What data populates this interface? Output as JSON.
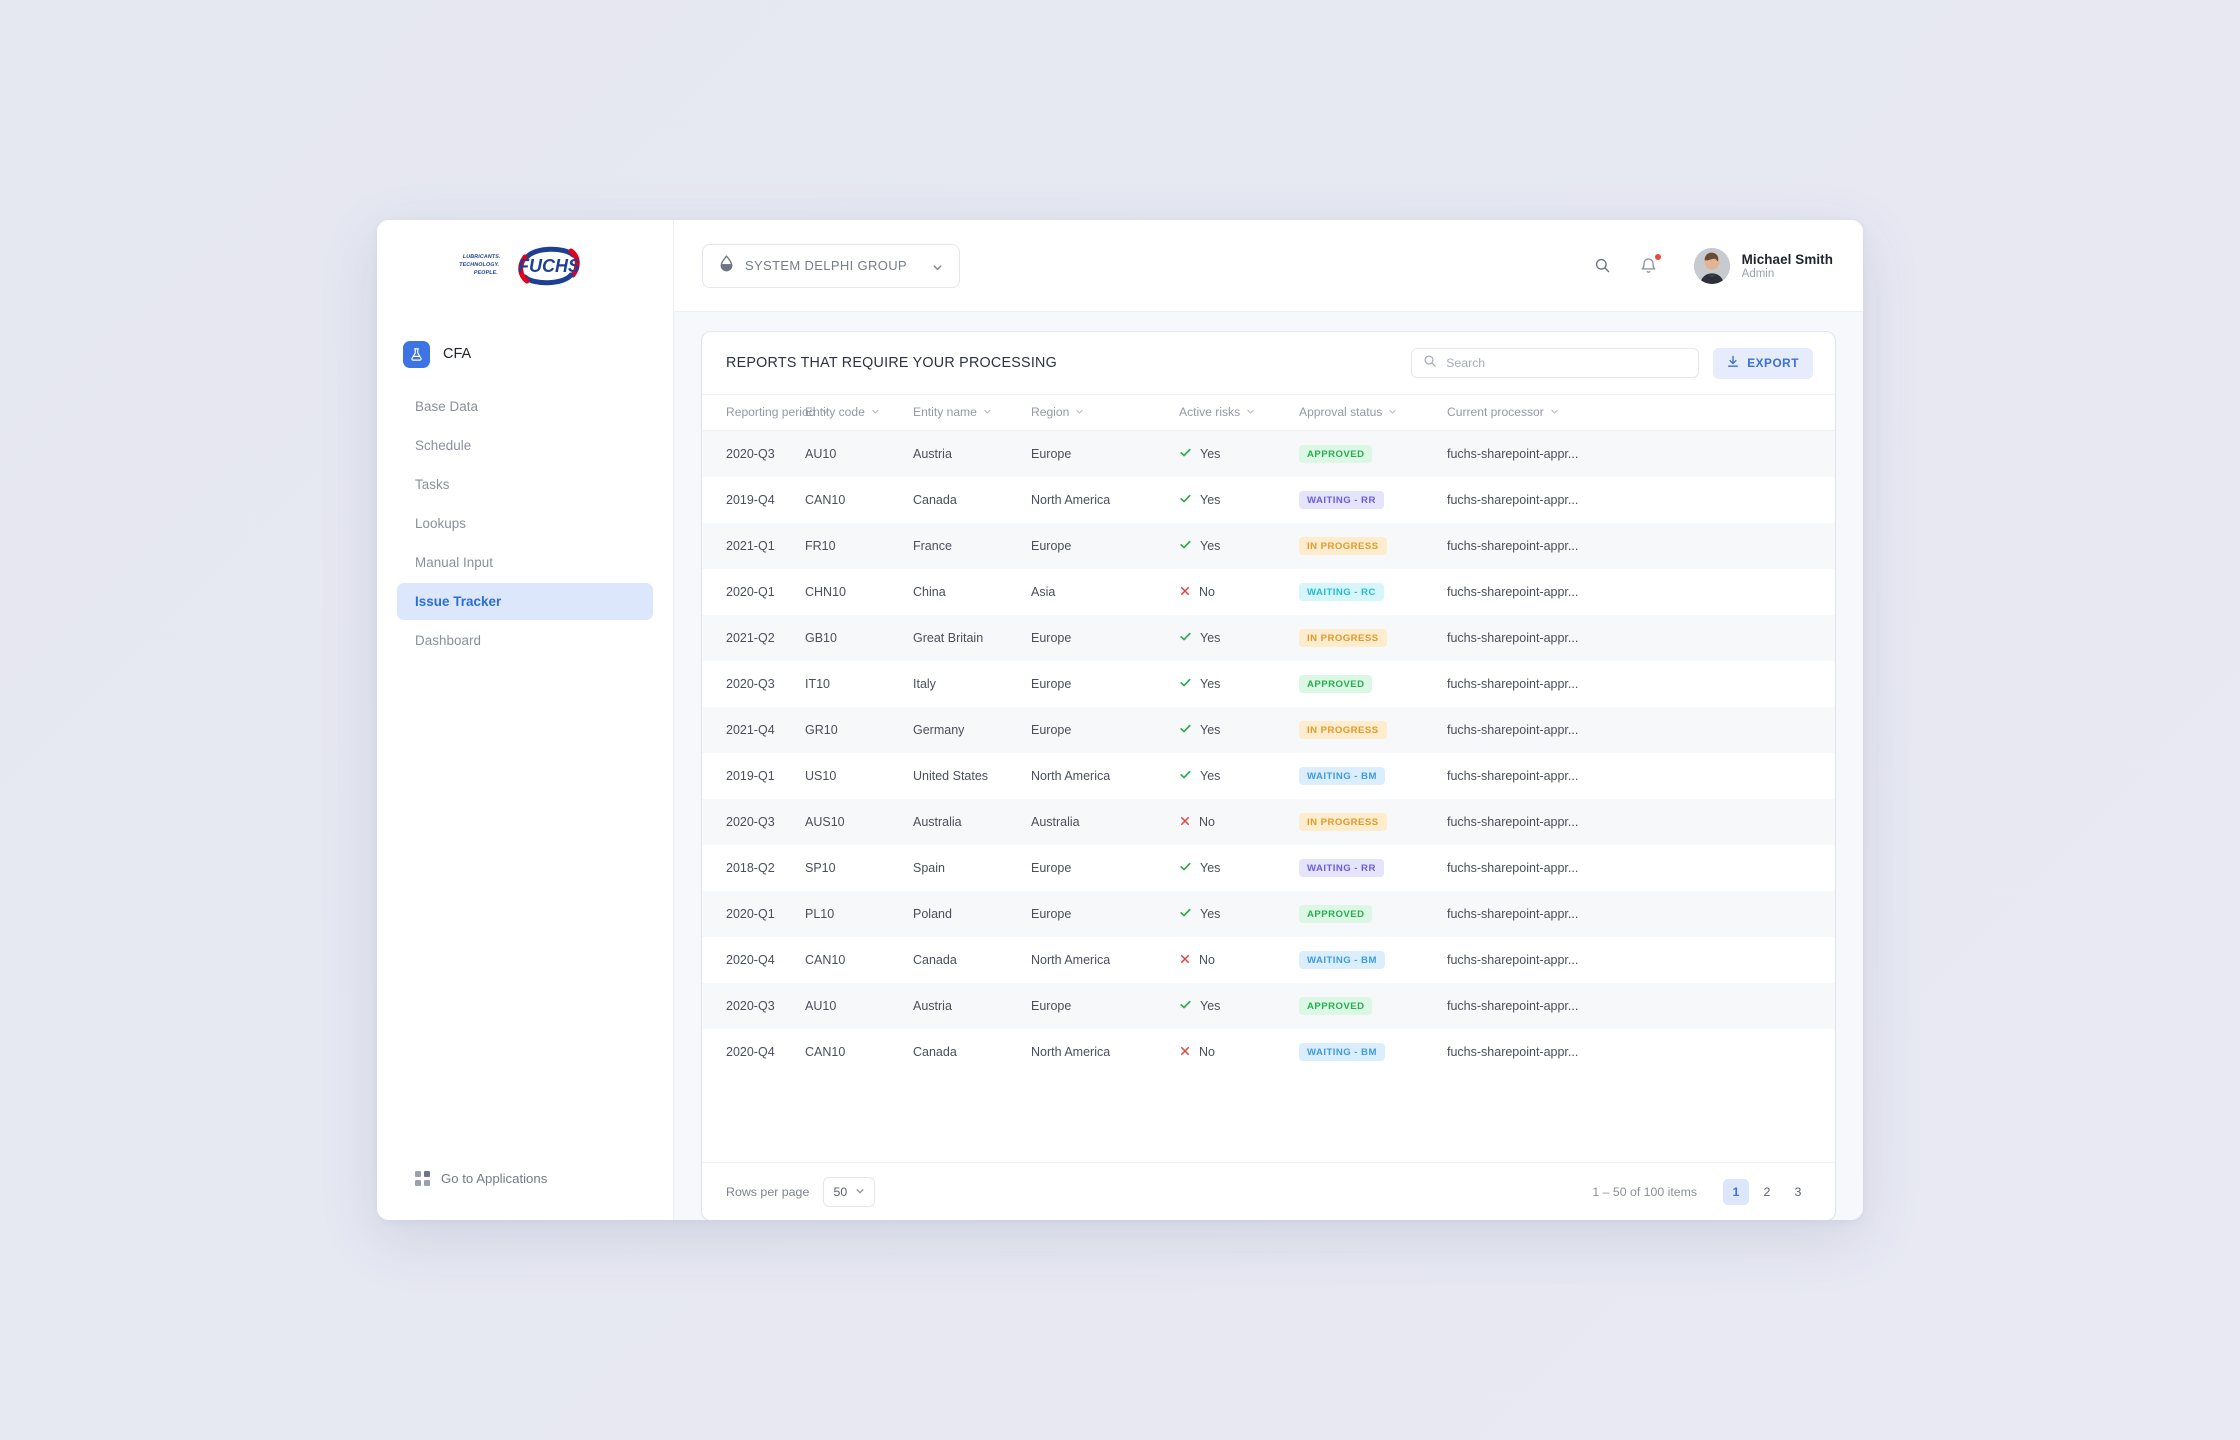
{
  "brand": {
    "logo_tagline": [
      "LUBRICANTS.",
      "TECHNOLOGY.",
      "PEOPLE."
    ],
    "logo_name": "FUCHS",
    "accent_blue": "#1d3f94",
    "accent_red": "#e2001a"
  },
  "sidebar": {
    "app_name": "CFA",
    "items": [
      {
        "label": "Base Data",
        "active": false
      },
      {
        "label": "Schedule",
        "active": false
      },
      {
        "label": "Tasks",
        "active": false
      },
      {
        "label": "Lookups",
        "active": false
      },
      {
        "label": "Manual Input",
        "active": false
      },
      {
        "label": "Issue Tracker",
        "active": true
      },
      {
        "label": "Dashboard",
        "active": false
      }
    ],
    "applications_link": "Go to Applications"
  },
  "topbar": {
    "group_selector": "SYSTEM DELPHI GROUP",
    "user_name": "Michael Smith",
    "user_role": "Admin",
    "has_notification": true
  },
  "card": {
    "title": "REPORTS THAT REQUIRE YOUR PROCESSING",
    "search_placeholder": "Search",
    "search_value": "",
    "export_label": "EXPORT"
  },
  "table": {
    "columns": [
      "Reporting period",
      "Entity code",
      "Entity name",
      "Region",
      "Active risks",
      "Approval status",
      "Current processor"
    ],
    "rows": [
      {
        "period": "2020-Q3",
        "code": "AU10",
        "name": "Austria",
        "region": "Europe",
        "risk": "Yes",
        "status": "APPROVED",
        "status_key": "approved",
        "processor": "fuchs-sharepoint-appr..."
      },
      {
        "period": "2019-Q4",
        "code": "CAN10",
        "name": "Canada",
        "region": "North America",
        "risk": "Yes",
        "status": "WAITING - RR",
        "status_key": "waiting_rr",
        "processor": "fuchs-sharepoint-appr..."
      },
      {
        "period": "2021-Q1",
        "code": "FR10",
        "name": "France",
        "region": "Europe",
        "risk": "Yes",
        "status": "IN PROGRESS",
        "status_key": "in_progress",
        "processor": "fuchs-sharepoint-appr..."
      },
      {
        "period": "2020-Q1",
        "code": "CHN10",
        "name": "China",
        "region": "Asia",
        "risk": "No",
        "status": "WAITING - RC",
        "status_key": "waiting_rc",
        "processor": "fuchs-sharepoint-appr..."
      },
      {
        "period": "2021-Q2",
        "code": "GB10",
        "name": "Great Britain",
        "region": "Europe",
        "risk": "Yes",
        "status": "IN PROGRESS",
        "status_key": "in_progress",
        "processor": "fuchs-sharepoint-appr..."
      },
      {
        "period": "2020-Q3",
        "code": "IT10",
        "name": "Italy",
        "region": "Europe",
        "risk": "Yes",
        "status": "APPROVED",
        "status_key": "approved",
        "processor": "fuchs-sharepoint-appr..."
      },
      {
        "period": "2021-Q4",
        "code": "GR10",
        "name": "Germany",
        "region": "Europe",
        "risk": "Yes",
        "status": "IN PROGRESS",
        "status_key": "in_progress",
        "processor": "fuchs-sharepoint-appr..."
      },
      {
        "period": "2019-Q1",
        "code": "US10",
        "name": "United States",
        "region": "North America",
        "risk": "Yes",
        "status": "WAITING - BM",
        "status_key": "waiting_bm",
        "processor": "fuchs-sharepoint-appr..."
      },
      {
        "period": "2020-Q3",
        "code": "AUS10",
        "name": "Australia",
        "region": "Australia",
        "risk": "No",
        "status": "IN PROGRESS",
        "status_key": "in_progress",
        "processor": "fuchs-sharepoint-appr..."
      },
      {
        "period": "2018-Q2",
        "code": "SP10",
        "name": "Spain",
        "region": "Europe",
        "risk": "Yes",
        "status": "WAITING - RR",
        "status_key": "waiting_rr",
        "processor": "fuchs-sharepoint-appr..."
      },
      {
        "period": "2020-Q1",
        "code": "PL10",
        "name": "Poland",
        "region": "Europe",
        "risk": "Yes",
        "status": "APPROVED",
        "status_key": "approved",
        "processor": "fuchs-sharepoint-appr..."
      },
      {
        "period": "2020-Q4",
        "code": "CAN10",
        "name": "Canada",
        "region": "North America",
        "risk": "No",
        "status": "WAITING - BM",
        "status_key": "waiting_bm",
        "processor": "fuchs-sharepoint-appr..."
      },
      {
        "period": "2020-Q3",
        "code": "AU10",
        "name": "Austria",
        "region": "Europe",
        "risk": "Yes",
        "status": "APPROVED",
        "status_key": "approved",
        "processor": "fuchs-sharepoint-appr..."
      },
      {
        "period": "2020-Q4",
        "code": "CAN10",
        "name": "Canada",
        "region": "North America",
        "risk": "No",
        "status": "WAITING - BM",
        "status_key": "waiting_bm",
        "processor": "fuchs-sharepoint-appr..."
      }
    ]
  },
  "status_colors": {
    "approved": {
      "bg": "#dcf7e3",
      "fg": "#27ae50"
    },
    "waiting_rr": {
      "bg": "#e5e4fb",
      "fg": "#6b5de0"
    },
    "in_progress": {
      "bg": "#fdeccd",
      "fg": "#e29a2b"
    },
    "waiting_rc": {
      "bg": "#d6f6fb",
      "fg": "#23bcd4"
    },
    "waiting_bm": {
      "bg": "#dbeefd",
      "fg": "#3e9ae3"
    }
  },
  "risk_colors": {
    "yes": "#2eaa4e",
    "no": "#e0483d"
  },
  "footer": {
    "rows_per_page_label": "Rows per page",
    "rows_per_page_value": "50",
    "range_label": "1 – 50 of 100 items",
    "pages": [
      "1",
      "2",
      "3"
    ],
    "active_page": "1"
  }
}
